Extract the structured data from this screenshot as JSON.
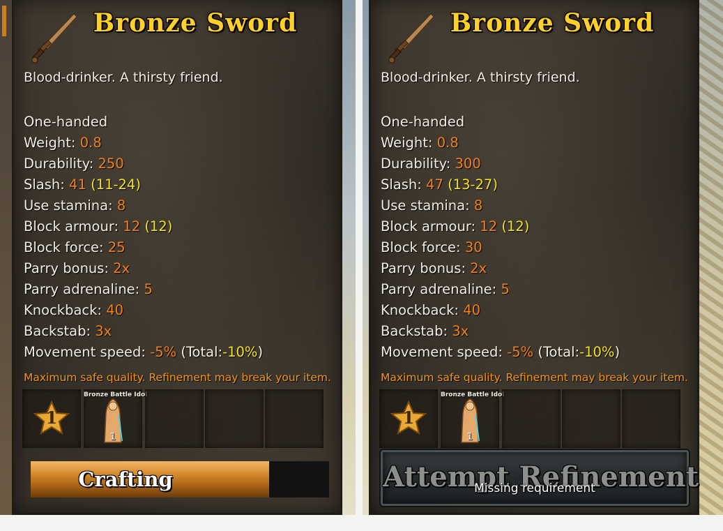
{
  "panels": [
    {
      "title": "Bronze Sword",
      "description": "Blood-drinker. A thirsty friend.",
      "handedness": "One-handed",
      "stats": [
        {
          "label": "Weight: ",
          "value": "0.8",
          "extra": ""
        },
        {
          "label": "Durability: ",
          "value": "250",
          "extra": ""
        },
        {
          "label": "Slash: ",
          "value": "41",
          "extra": " (11-24)"
        },
        {
          "label": "Use stamina: ",
          "value": "8",
          "extra": ""
        },
        {
          "label": "Block armour: ",
          "value": "12",
          "extra": " (12)"
        },
        {
          "label": "Block force: ",
          "value": "25",
          "extra": ""
        },
        {
          "label": "Parry bonus: ",
          "value": "2x",
          "extra": ""
        },
        {
          "label": "Parry adrenaline: ",
          "value": "5",
          "extra": ""
        },
        {
          "label": "Knockback: ",
          "value": "40",
          "extra": ""
        },
        {
          "label": "Backstab: ",
          "value": "3x",
          "extra": ""
        }
      ],
      "movement": {
        "label": "Movement speed: ",
        "value": "-5%",
        "total_prefix": " (Total:",
        "total_value": "-10%",
        "total_suffix": ")"
      },
      "warning": "Maximum safe quality. Refinement may break your item.",
      "quality_level": "1",
      "requirement": {
        "name": "Bronze Battle Idol",
        "count": "1"
      },
      "action": {
        "label": "Crafting",
        "progress": 0.8
      }
    },
    {
      "title": "Bronze Sword",
      "description": "Blood-drinker. A thirsty friend.",
      "handedness": "One-handed",
      "stats": [
        {
          "label": "Weight: ",
          "value": "0.8",
          "extra": ""
        },
        {
          "label": "Durability: ",
          "value": "300",
          "extra": ""
        },
        {
          "label": "Slash: ",
          "value": "47",
          "extra": " (13-27)"
        },
        {
          "label": "Use stamina: ",
          "value": "8",
          "extra": ""
        },
        {
          "label": "Block armour: ",
          "value": "12",
          "extra": " (12)"
        },
        {
          "label": "Block force: ",
          "value": "30",
          "extra": ""
        },
        {
          "label": "Parry bonus: ",
          "value": "2x",
          "extra": ""
        },
        {
          "label": "Parry adrenaline: ",
          "value": "5",
          "extra": ""
        },
        {
          "label": "Knockback: ",
          "value": "40",
          "extra": ""
        },
        {
          "label": "Backstab: ",
          "value": "3x",
          "extra": ""
        }
      ],
      "movement": {
        "label": "Movement speed: ",
        "value": "-5%",
        "total_prefix": " (Total:",
        "total_value": "-10%",
        "total_suffix": ")"
      },
      "warning": "Maximum safe quality. Refinement may break your item.",
      "quality_level": "1",
      "requirement": {
        "name": "Bronze Battle Idol",
        "count": "1"
      },
      "action": {
        "label": "Attempt Refinement",
        "status": "Missing requirement"
      }
    }
  ],
  "colors": {
    "title": "#ffcf2a",
    "stat_value": "#f0821e",
    "stat_extra": "#f3e21c",
    "warning": "#f0961e"
  }
}
